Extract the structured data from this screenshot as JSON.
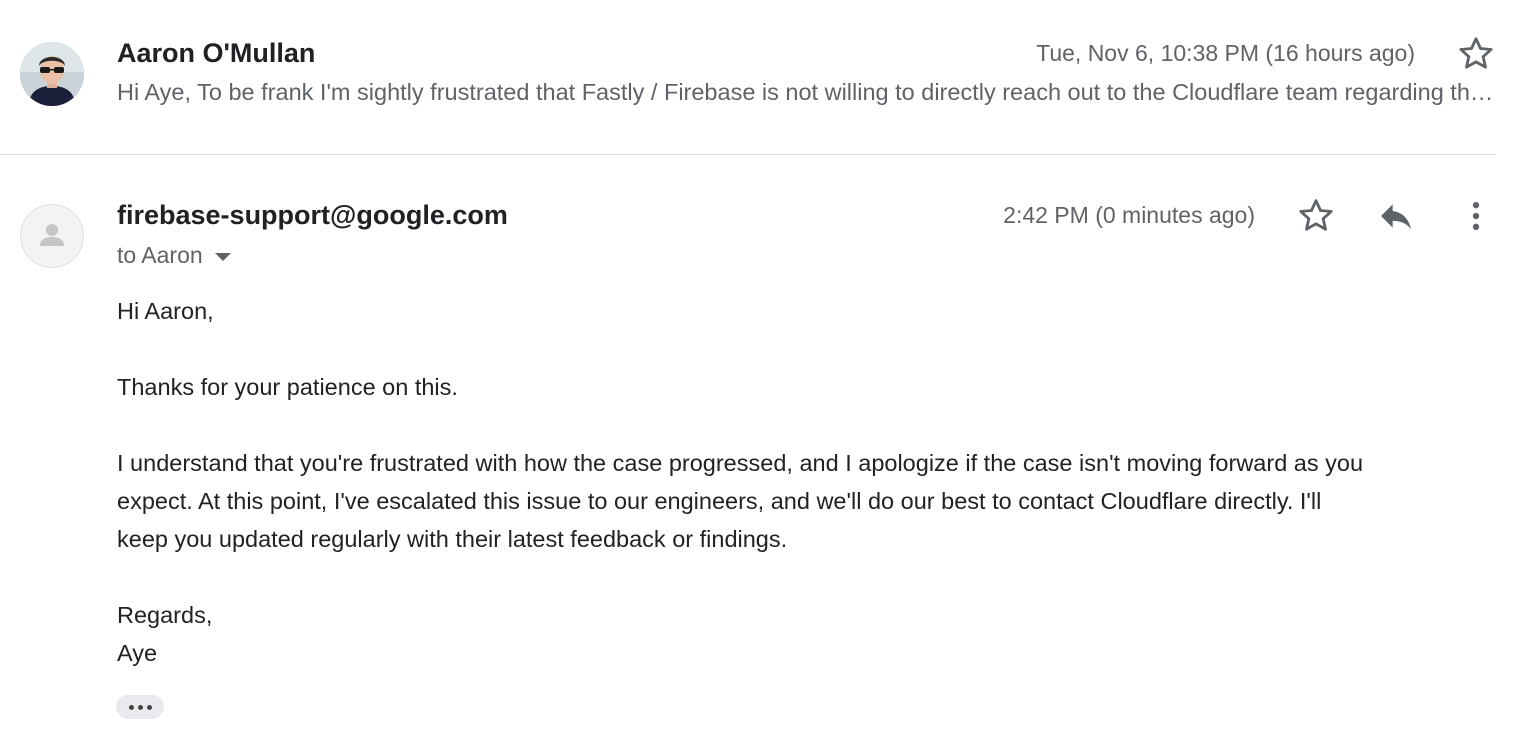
{
  "thread": {
    "previous_message": {
      "sender": "Aaron O'Mullan",
      "date": "Tue, Nov 6, 10:38 PM (16 hours ago)",
      "snippet": "Hi Aye, To be frank I'm sightly frustrated that Fastly / Firebase is not willing to directly reach out to the Cloudflare team regarding this issue...",
      "avatar_icon": "user-photo-avatar",
      "star_icon": "star-outline-icon"
    },
    "current_message": {
      "sender": "firebase-support@google.com",
      "date": "2:42 PM (0 minutes ago)",
      "to_label": "to Aaron",
      "avatar_icon": "default-person-avatar",
      "icons": [
        "star-outline-icon",
        "reply-icon",
        "more-vert-icon",
        "chevron-down-icon"
      ],
      "body": {
        "greeting": "Hi Aaron,",
        "para1": "Thanks for your patience on this.",
        "para2_line1": "I understand that you're frustrated with how the case progressed, and I apologize if the case isn't moving forward as you",
        "para2_line2": "expect. At this point, I've escalated this issue to our engineers, and we'll do our best to contact Cloudflare directly. I'll",
        "para2_line3": "keep you updated regularly with their latest feedback or findings.",
        "closing": "Regards,",
        "signature": "Aye"
      },
      "show_trimmed_icon": "ellipsis-icon"
    }
  },
  "colors": {
    "text_primary": "#202124",
    "text_secondary": "#5f6368",
    "icon": "#5f6368",
    "divider": "#dadce0"
  }
}
